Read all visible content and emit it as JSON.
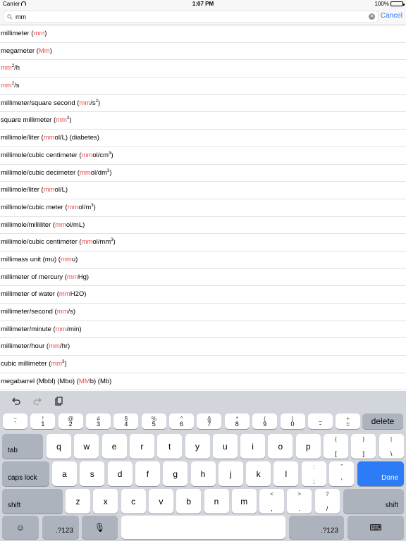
{
  "status_bar": {
    "carrier": "Carrier",
    "time": "1:07 PM",
    "battery": "100%",
    "battery_level": 1.0
  },
  "search": {
    "query": "mm",
    "cancel_label": "Cancel"
  },
  "highlight_color": "#ec4b4b",
  "results": [
    {
      "before": "millimeter (",
      "match": "mm",
      "after": ")"
    },
    {
      "before": "megameter (",
      "match": "Mm",
      "after": ")"
    },
    {
      "before": "",
      "match": "mm",
      "after": "²/h"
    },
    {
      "before": "",
      "match": "mm",
      "after": "²/s"
    },
    {
      "before": "millimeter/square second (",
      "match": "mm",
      "after": "/s²)"
    },
    {
      "before": "square millimeter (",
      "match": "mm",
      "after": "²)"
    },
    {
      "before": "millimole/liter (",
      "match": "mm",
      "after": "ol/L) (diabetes)"
    },
    {
      "before": "millimole/cubic centimeter (",
      "match": "mm",
      "after": "ol/cm³)"
    },
    {
      "before": "millimole/cubic decimeter (",
      "match": "mm",
      "after": "ol/dm³)"
    },
    {
      "before": "millimole/liter (",
      "match": "mm",
      "after": "ol/L)"
    },
    {
      "before": "millimole/cubic meter (",
      "match": "mm",
      "after": "ol/m³)"
    },
    {
      "before": "millimole/milliliter (",
      "match": "mm",
      "after": "ol/mL)"
    },
    {
      "before": "millimole/cubic centimeter (",
      "match": "mm",
      "after": "ol/mm³)"
    },
    {
      "before": "millimass unit (mu) (",
      "match": "mm",
      "after": "u)"
    },
    {
      "before": "millimeter of mercury (",
      "match": "mm",
      "after": "Hg)"
    },
    {
      "before": "millimeter of water (",
      "match": "mm",
      "after": "H2O)"
    },
    {
      "before": "millimeter/second (",
      "match": "mm",
      "after": "/s)"
    },
    {
      "before": "millimeter/minute (",
      "match": "mm",
      "after": "/min)"
    },
    {
      "before": "millimeter/hour (",
      "match": "mm",
      "after": "/hr)"
    },
    {
      "before": "cubic millimeter (",
      "match": "mm",
      "after": "³)"
    },
    {
      "before": "megabarrel (Mbbl) (Mbo) (",
      "match": "MM",
      "after": "b) (Mb)"
    }
  ],
  "keyboard": {
    "toolbar_icons": [
      "undo-icon",
      "redo-icon",
      "paste-icon"
    ],
    "number_row": [
      {
        "top": "~",
        "bot": "`"
      },
      {
        "top": "!",
        "bot": "1"
      },
      {
        "top": "@",
        "bot": "2"
      },
      {
        "top": "#",
        "bot": "3"
      },
      {
        "top": "$",
        "bot": "4"
      },
      {
        "top": "%",
        "bot": "5"
      },
      {
        "top": "^",
        "bot": "6"
      },
      {
        "top": "&",
        "bot": "7"
      },
      {
        "top": "*",
        "bot": "8"
      },
      {
        "top": "(",
        "bot": "9"
      },
      {
        "top": ")",
        "bot": "0"
      },
      {
        "top": "_",
        "bot": "-"
      },
      {
        "top": "+",
        "bot": "="
      }
    ],
    "delete": "delete",
    "tab": "tab",
    "row_q": [
      "q",
      "w",
      "e",
      "r",
      "t",
      "y",
      "u",
      "i",
      "o",
      "p"
    ],
    "row_q_sym": [
      {
        "top": "{",
        "bot": "["
      },
      {
        "top": "}",
        "bot": "]"
      },
      {
        "top": "|",
        "bot": "\\"
      }
    ],
    "caps_lock": "caps lock",
    "row_a": [
      "a",
      "s",
      "d",
      "f",
      "g",
      "h",
      "j",
      "k",
      "l"
    ],
    "row_a_sym": [
      {
        "top": ":",
        "bot": ";"
      },
      {
        "top": "”",
        "bot": "’"
      }
    ],
    "done": "Done",
    "shift": "shift",
    "row_z": [
      "z",
      "x",
      "c",
      "v",
      "b",
      "n",
      "m"
    ],
    "row_z_sym": [
      {
        "top": "<",
        "bot": ","
      },
      {
        "top": ">",
        "bot": "."
      },
      {
        "top": "?",
        "bot": "/"
      }
    ],
    "numbers_key": ".?123",
    "emoji_icon": "emoji-icon",
    "mic_icon": "microphone-icon",
    "hide_icon": "keyboard-hide-icon"
  }
}
